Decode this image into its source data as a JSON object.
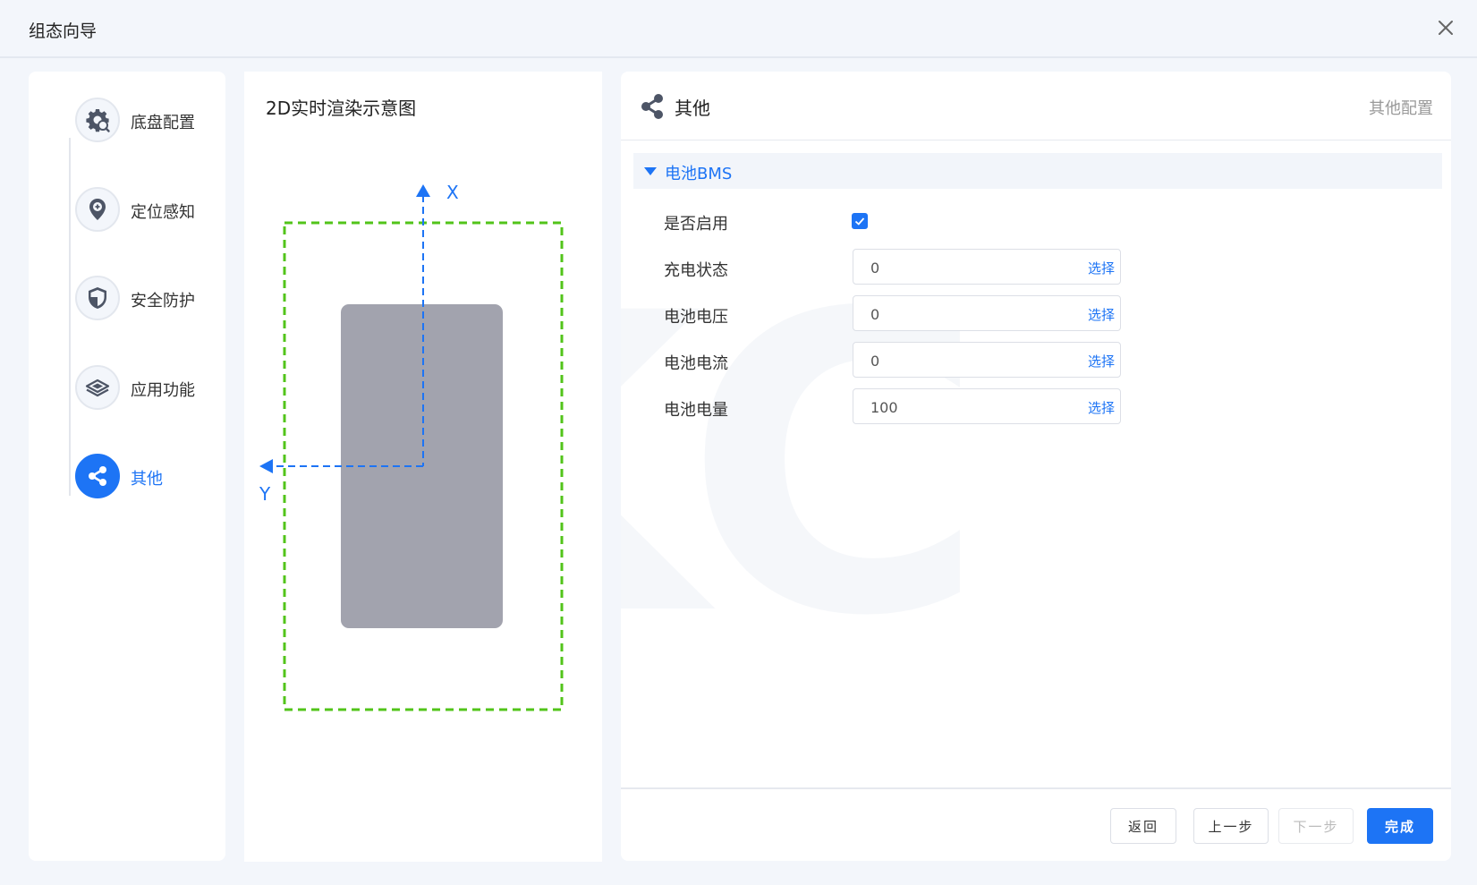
{
  "window": {
    "title": "组态向导"
  },
  "steps": [
    {
      "label": "底盘配置",
      "icon": "gear-icon"
    },
    {
      "label": "定位感知",
      "icon": "location-pin-icon"
    },
    {
      "label": "安全防护",
      "icon": "shield-icon"
    },
    {
      "label": "应用功能",
      "icon": "layers-icon"
    },
    {
      "label": "其他",
      "icon": "share-icon",
      "active": true
    }
  ],
  "preview": {
    "title": "2D实时渲染示意图",
    "axis_x": "X",
    "axis_y": "Y",
    "watermark": "KC"
  },
  "main": {
    "header_title": "其他",
    "header_right": "其他配置",
    "section_title": "电池BMS",
    "fields": [
      {
        "label": "是否启用",
        "type": "checkbox",
        "checked": true
      },
      {
        "label": "充电状态",
        "value": "0",
        "action": "选择"
      },
      {
        "label": "电池电压",
        "value": "0",
        "action": "选择"
      },
      {
        "label": "电池电流",
        "value": "0",
        "action": "选择"
      },
      {
        "label": "电池电量",
        "value": "100",
        "action": "选择"
      }
    ]
  },
  "footer": {
    "back": "返回",
    "prev": "上一步",
    "next": "下一步",
    "finish": "完成"
  },
  "colors": {
    "accent": "#1d74f5",
    "boundary": "#52c41a",
    "vehicle": "#a2a3ae"
  }
}
